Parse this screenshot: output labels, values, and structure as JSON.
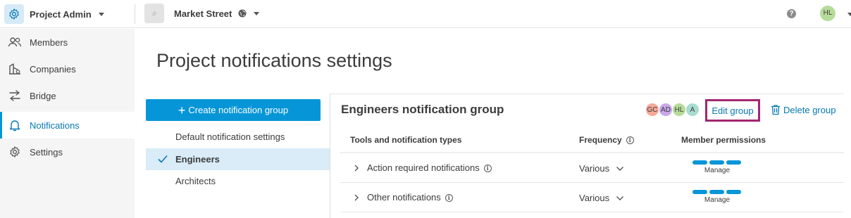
{
  "topbar": {
    "app_title": "Project Admin",
    "project_name": "Market Street",
    "help_symbol": "?",
    "user_initials": "HL"
  },
  "sidebar": {
    "items": [
      {
        "label": "Members",
        "icon": "members-icon",
        "active": false
      },
      {
        "label": "Companies",
        "icon": "companies-icon",
        "active": false
      },
      {
        "label": "Bridge",
        "icon": "bridge-icon",
        "active": false
      },
      {
        "label": "Notifications",
        "icon": "bell-icon",
        "active": true
      },
      {
        "label": "Settings",
        "icon": "gear-icon",
        "active": false
      }
    ]
  },
  "page": {
    "title": "Project notifications settings"
  },
  "create_button": {
    "label": "Create notification group"
  },
  "groups": [
    {
      "label": "Default notification settings",
      "selected": false
    },
    {
      "label": "Engineers",
      "selected": true
    },
    {
      "label": "Architects",
      "selected": false
    }
  ],
  "group_panel": {
    "title": "Engineers notification group",
    "members": [
      {
        "initials": "GC",
        "color": "#f4a99a"
      },
      {
        "initials": "AD",
        "color": "#c9a7ea"
      },
      {
        "initials": "HL",
        "color": "#b6dc9a"
      },
      {
        "initials": "A",
        "color": "#a9dcd0"
      }
    ],
    "edit_label": "Edit group",
    "delete_label": "Delete group"
  },
  "table": {
    "headers": {
      "tools": "Tools and notification types",
      "frequency": "Frequency",
      "permissions": "Member permissions"
    },
    "rows": [
      {
        "label": "Action required notifications",
        "frequency": "Various",
        "permission": "Manage"
      },
      {
        "label": "Other notifications",
        "frequency": "Various",
        "permission": "Manage"
      }
    ]
  },
  "colors": {
    "accent": "#0696d7",
    "link": "#0678b4",
    "highlight_border": "#a3266f",
    "selected_row": "#d9ecf7"
  }
}
